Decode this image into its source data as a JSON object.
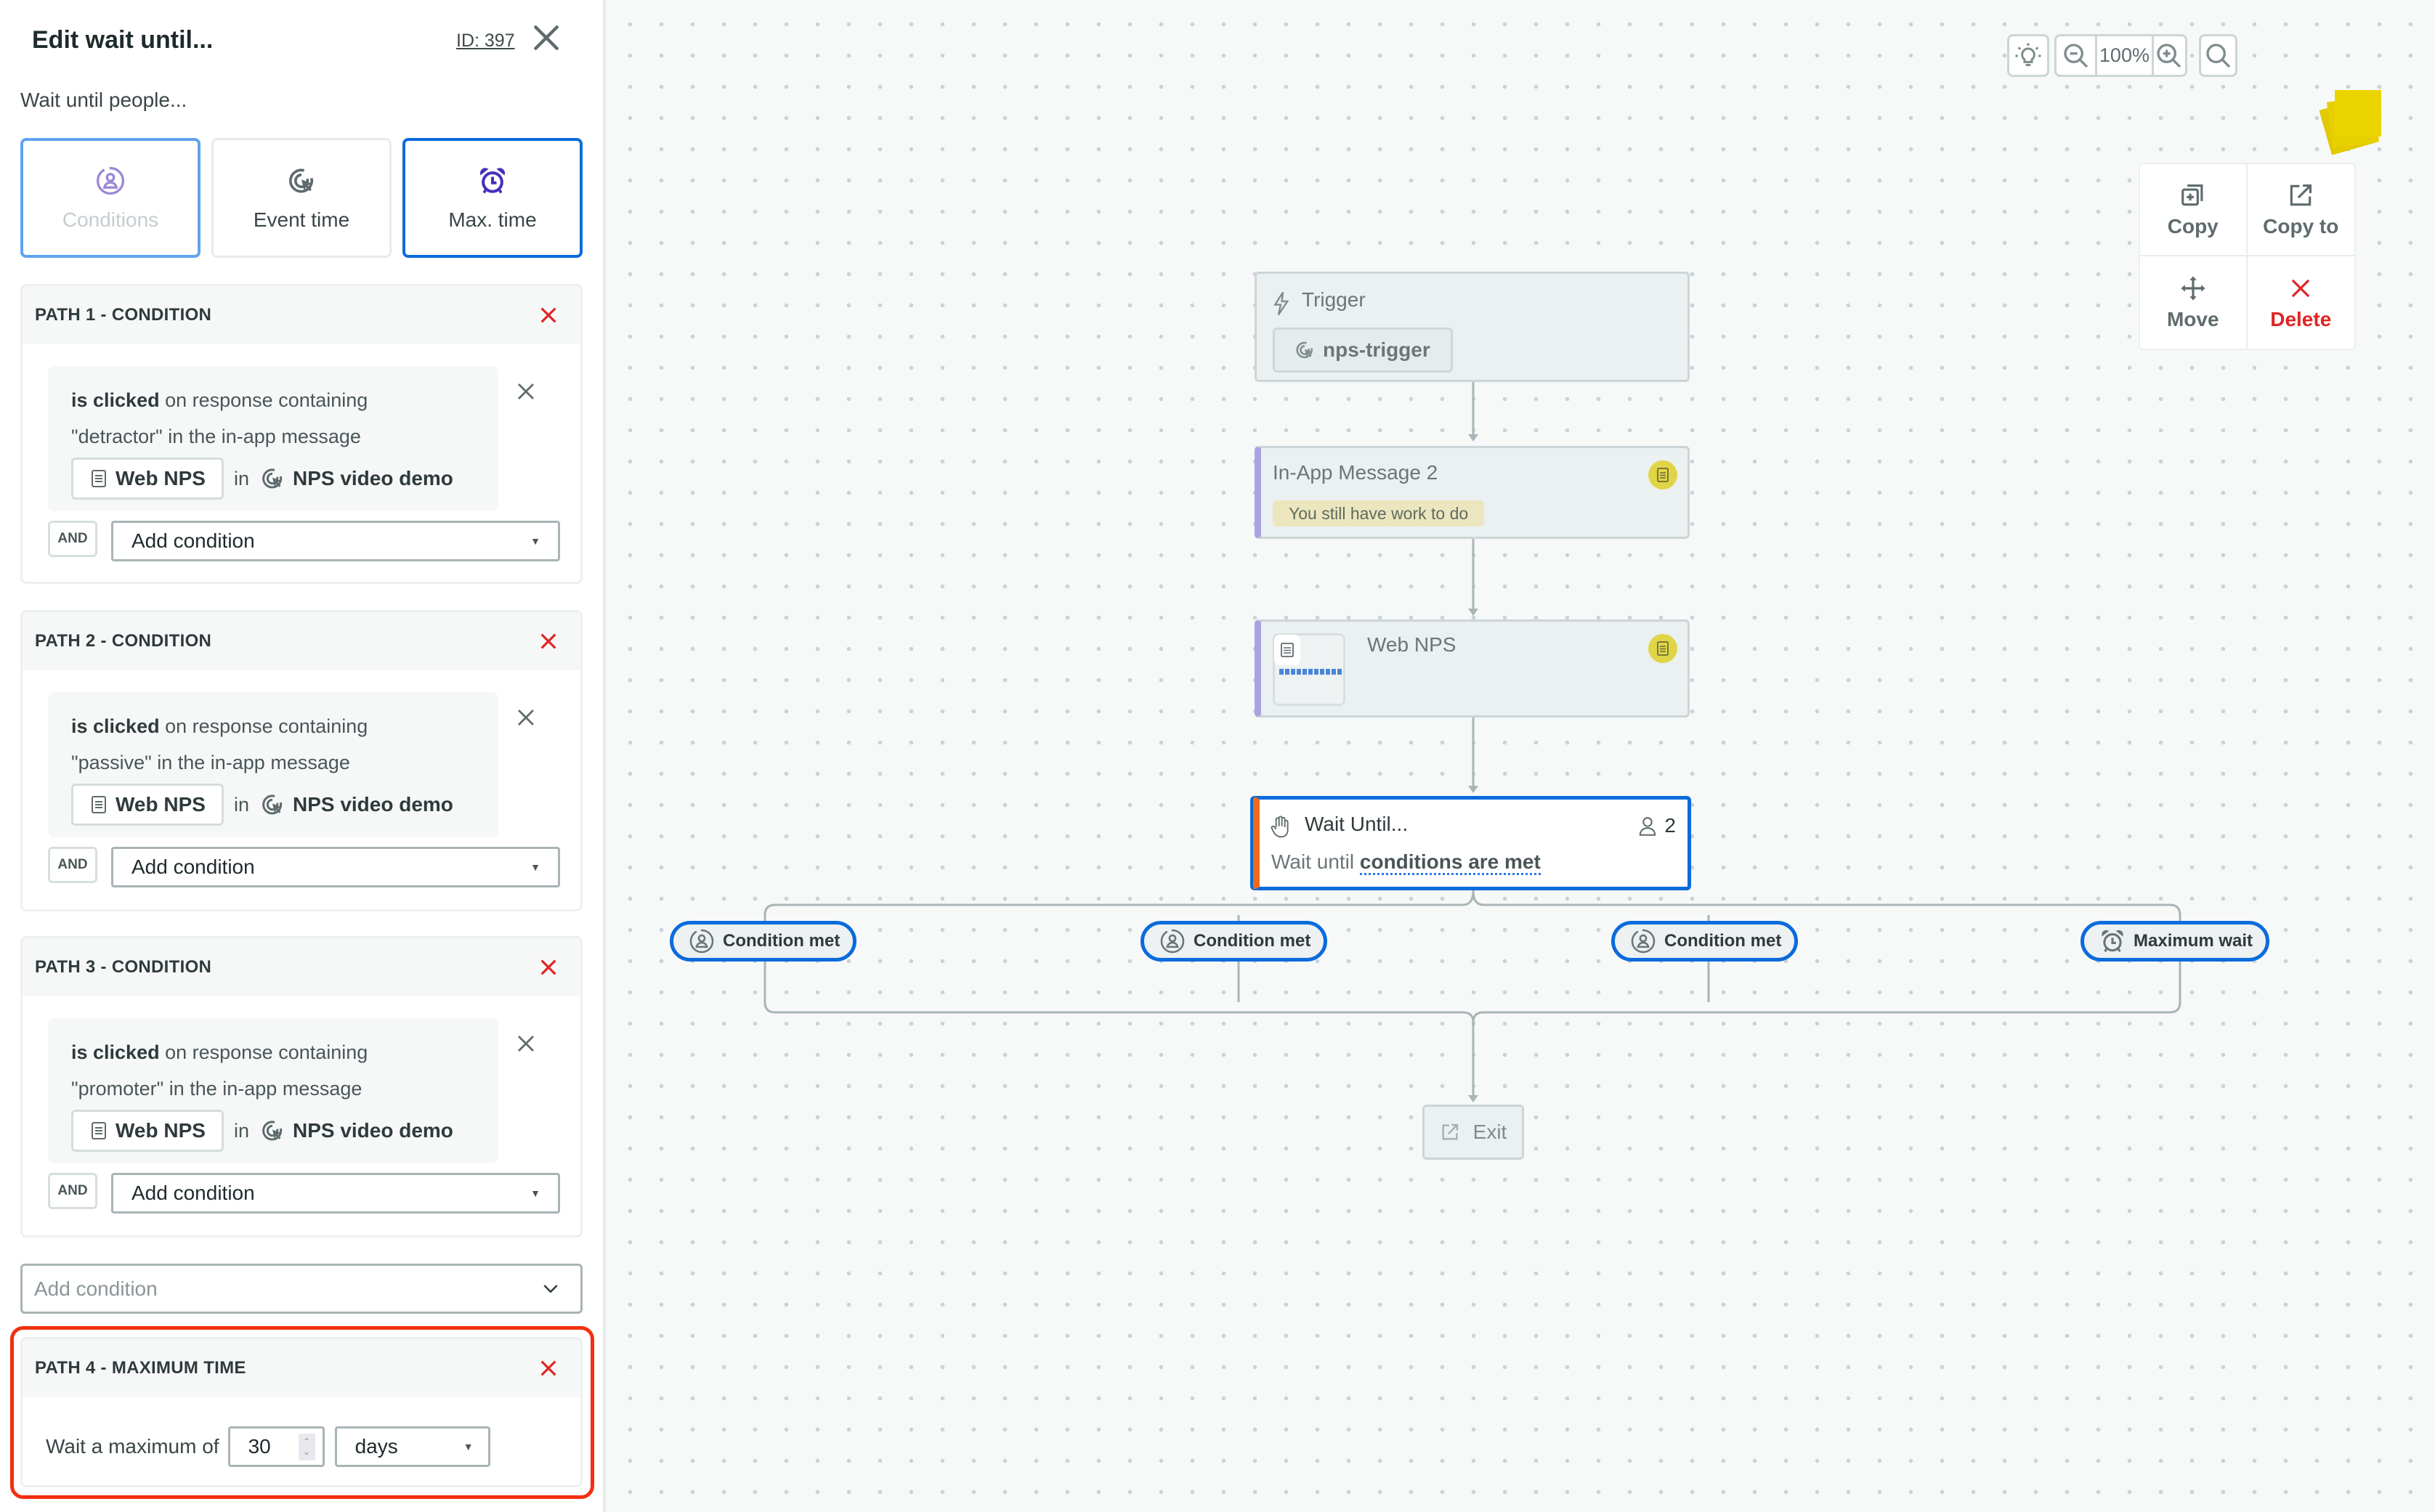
{
  "sidebar": {
    "title": "Edit wait until...",
    "id_label": "ID: 397",
    "subtitle": "Wait until people...",
    "tiles": [
      {
        "label": "Conditions",
        "icon": "person-circle-icon",
        "state": "disabled"
      },
      {
        "label": "Event time",
        "icon": "click-target-icon",
        "state": "default"
      },
      {
        "label": "Max. time",
        "icon": "alarm-clock-icon",
        "state": "selected"
      }
    ],
    "paths": [
      {
        "header": "PATH 1 - CONDITION",
        "verb": "is clicked",
        "text_1": " on response containing",
        "text_2": "\"detractor\" in the in-app message",
        "message": "Web NPS",
        "in": "in",
        "campaign": "NPS video demo",
        "and": "AND",
        "add_condition": "Add condition"
      },
      {
        "header": "PATH 2 - CONDITION",
        "verb": "is clicked",
        "text_1": " on response containing",
        "text_2": "\"passive\" in the in-app message",
        "message": "Web NPS",
        "in": "in",
        "campaign": "NPS video demo",
        "and": "AND",
        "add_condition": "Add condition"
      },
      {
        "header": "PATH 3 - CONDITION",
        "verb": "is clicked",
        "text_1": " on response containing",
        "text_2": "\"promoter\" in the in-app message",
        "message": "Web NPS",
        "in": "in",
        "campaign": "NPS video demo",
        "and": "AND",
        "add_condition": "Add condition"
      }
    ],
    "add_condition_placeholder": "Add condition",
    "max_path": {
      "header": "PATH 4 - MAXIMUM TIME",
      "label": "Wait a maximum of",
      "value": "30",
      "unit": "days"
    }
  },
  "canvas": {
    "toolbar": {
      "zoom_level": "100%"
    },
    "context_menu": {
      "copy": "Copy",
      "copy_to": "Copy to",
      "move": "Move",
      "delete": "Delete"
    },
    "nodes": {
      "trigger": {
        "title": "Trigger",
        "chip": "nps-trigger"
      },
      "in_app": {
        "title": "In-App Message 2",
        "badge": "You still have work to do"
      },
      "web_nps": {
        "title": "Web NPS"
      },
      "wait": {
        "title": "Wait Until...",
        "count": "2",
        "desc_prefix": "Wait until ",
        "desc_link": "conditions are met"
      },
      "exit": {
        "title": "Exit"
      }
    },
    "branches": [
      {
        "label": "Condition met",
        "icon": "person-circle-icon"
      },
      {
        "label": "Condition met",
        "icon": "person-circle-icon"
      },
      {
        "label": "Condition met",
        "icon": "person-circle-icon"
      },
      {
        "label": "Maximum wait",
        "icon": "alarm-clock-icon"
      }
    ]
  },
  "colors": {
    "accent": "#0a6bdc",
    "danger": "#e02424",
    "highlight": "#f2300f",
    "wait_stripe": "#f26a1b",
    "message_stripe": "#a8a4df",
    "note": "#ecd400"
  }
}
